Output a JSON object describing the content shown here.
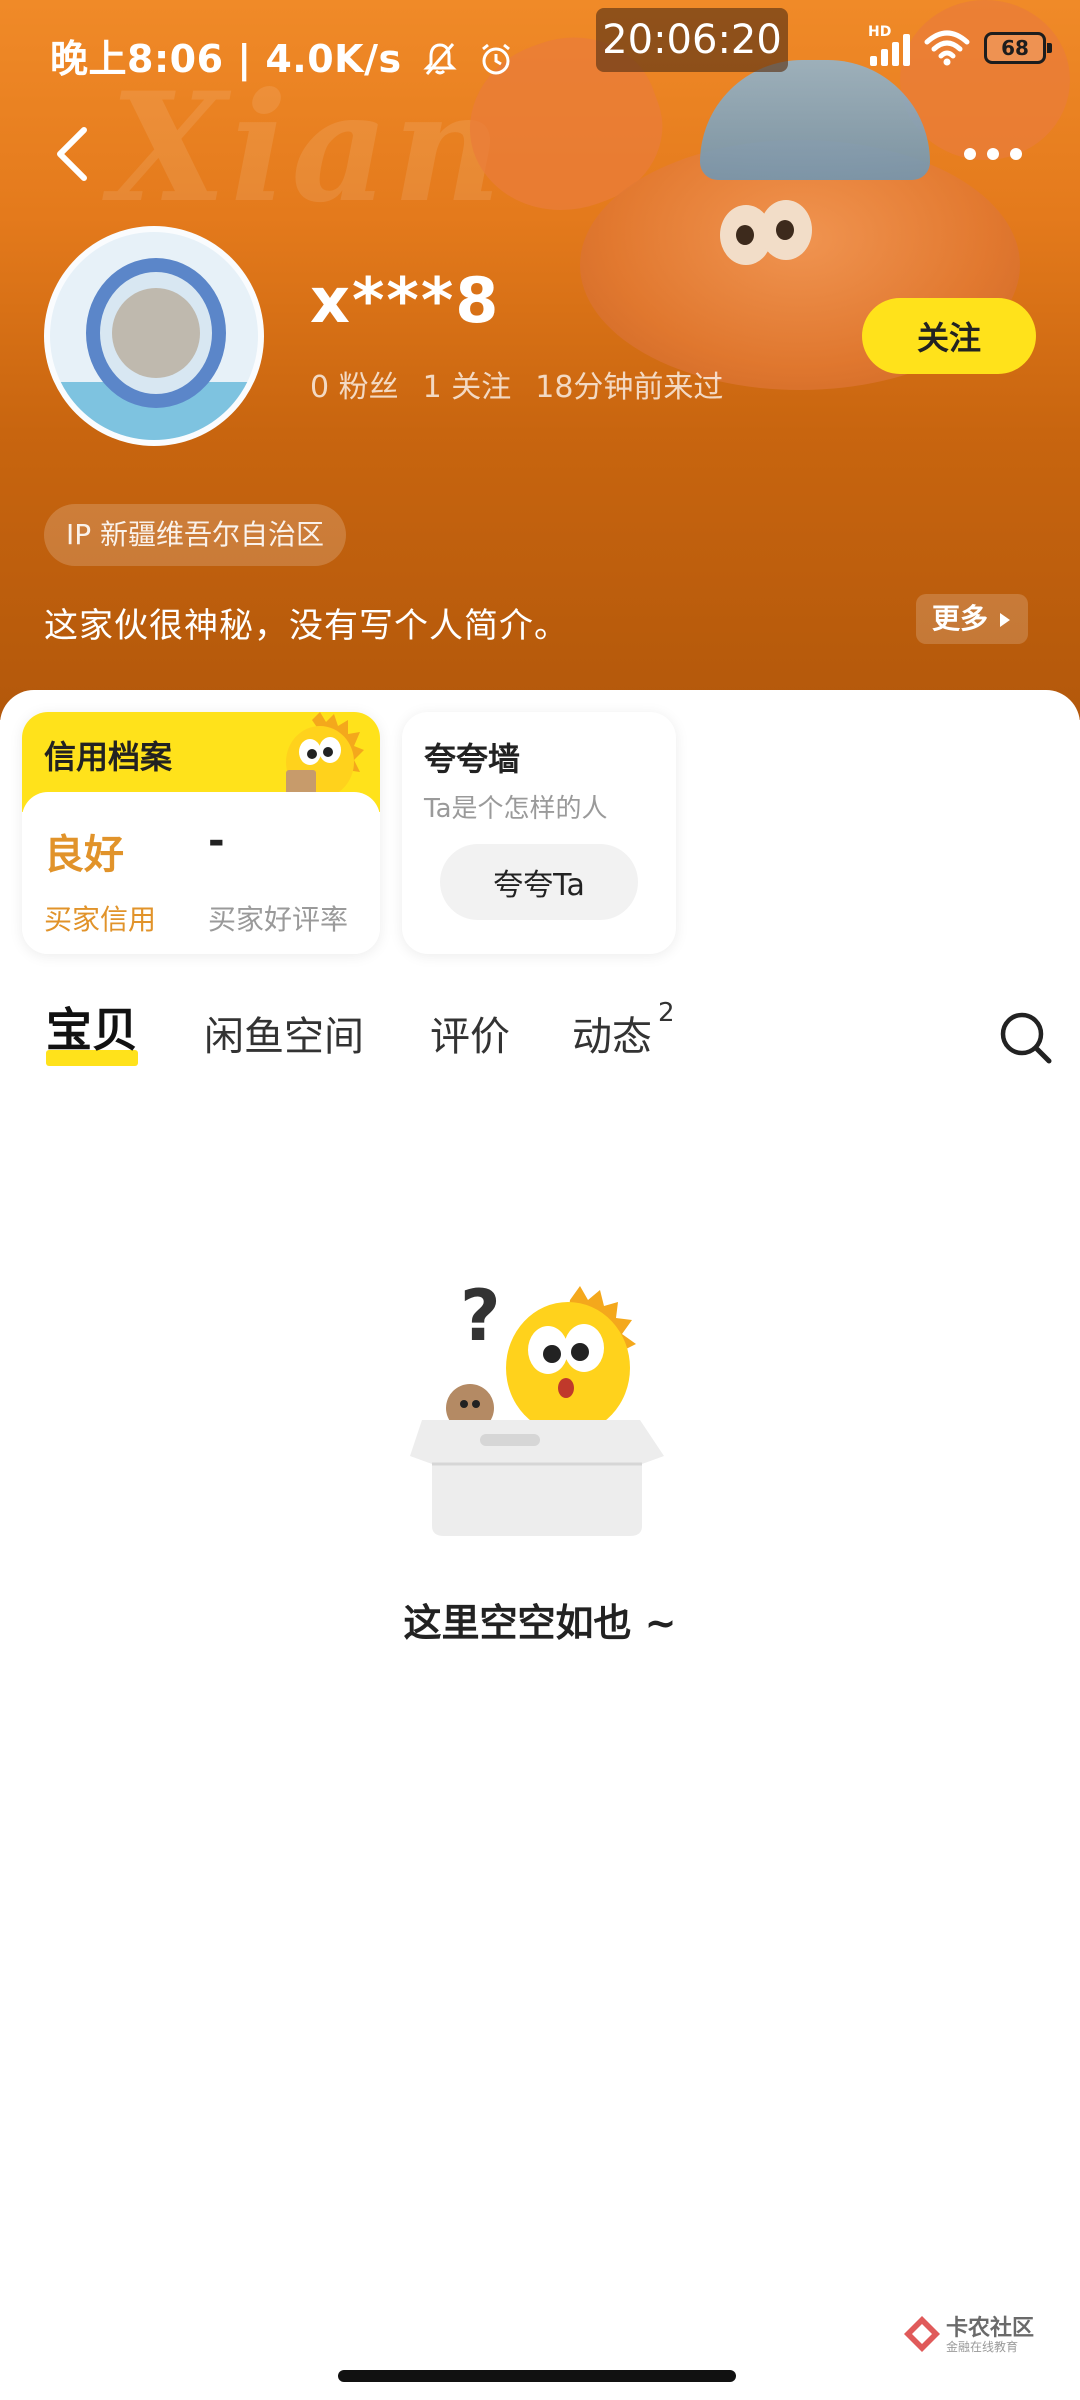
{
  "status_bar": {
    "left_text": "晚上8:06 | 4.0K/s",
    "clock": "20:06:20",
    "network_label": "HD",
    "battery": "68",
    "icons": [
      "mute-bell-icon",
      "alarm-icon",
      "signal-icon",
      "wifi-icon",
      "battery-icon"
    ]
  },
  "header": {
    "back_icon": "chevron-left-icon",
    "more_icon": "more-dots-icon",
    "username": "x***8",
    "fans": "0 粉丝",
    "following": "1 关注",
    "last_seen": "18分钟前来过",
    "follow_label": "关注",
    "ip_location": "IP 新疆维吾尔自治区",
    "bio": "这家伙很神秘，没有写个人简介。",
    "more_label": "更多"
  },
  "credit": {
    "title": "信用档案",
    "buyer_credit_value": "良好",
    "buyer_credit_label": "买家信用",
    "good_rate_value": "-",
    "good_rate_label": "买家好评率"
  },
  "praise_wall": {
    "title": "夸夸墙",
    "subtitle": "Ta是个怎样的人",
    "button_label": "夸夸Ta"
  },
  "tabs": [
    {
      "label": "宝贝",
      "active": true
    },
    {
      "label": "闲鱼空间",
      "active": false
    },
    {
      "label": "评价",
      "active": false
    },
    {
      "label": "动态",
      "active": false,
      "badge": "2"
    }
  ],
  "empty_state": {
    "text": "这里空空如也 ~"
  },
  "watermark": {
    "brand": "卡农社区",
    "tagline": "金融在线教育"
  },
  "colors": {
    "accent_yellow": "#ffe21b",
    "header_orange": "#e47a1c",
    "credit_orange": "#e1932a"
  }
}
